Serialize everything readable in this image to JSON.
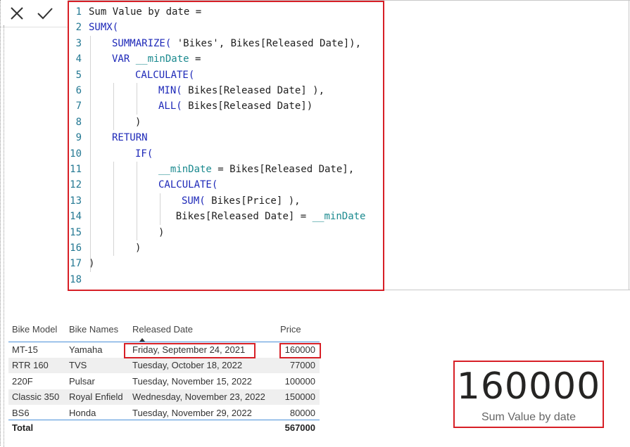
{
  "toolbar": {
    "cancel_icon": "close-icon",
    "commit_icon": "check-icon"
  },
  "editor": {
    "lines": [
      {
        "n": "1",
        "indent": 0,
        "tokens": [
          {
            "t": "Sum Value by date =",
            "c": "code"
          }
        ]
      },
      {
        "n": "2",
        "indent": 0,
        "tokens": [
          {
            "t": "SUMX(",
            "c": "fn"
          }
        ]
      },
      {
        "n": "3",
        "indent": 1,
        "tokens": [
          {
            "t": "SUMMARIZE(",
            "c": "fn"
          },
          {
            "t": " 'Bikes', Bikes[Released Date]),",
            "c": "code"
          }
        ]
      },
      {
        "n": "4",
        "indent": 1,
        "tokens": [
          {
            "t": "VAR ",
            "c": "kw"
          },
          {
            "t": "__minDate",
            "c": "var"
          },
          {
            "t": " =",
            "c": "code"
          }
        ]
      },
      {
        "n": "5",
        "indent": 2,
        "tokens": [
          {
            "t": "CALCULATE(",
            "c": "fn"
          }
        ]
      },
      {
        "n": "6",
        "indent": 3,
        "tokens": [
          {
            "t": "MIN(",
            "c": "fn"
          },
          {
            "t": " Bikes[Released Date] ),",
            "c": "code"
          }
        ]
      },
      {
        "n": "7",
        "indent": 3,
        "tokens": [
          {
            "t": "ALL(",
            "c": "fn"
          },
          {
            "t": " Bikes[Released Date])",
            "c": "code"
          }
        ]
      },
      {
        "n": "8",
        "indent": 2,
        "tokens": [
          {
            "t": ")",
            "c": "code"
          }
        ]
      },
      {
        "n": "9",
        "indent": 1,
        "tokens": [
          {
            "t": "RETURN",
            "c": "kw"
          }
        ]
      },
      {
        "n": "10",
        "indent": 2,
        "tokens": [
          {
            "t": "IF(",
            "c": "fn"
          }
        ]
      },
      {
        "n": "11",
        "indent": 3,
        "tokens": [
          {
            "t": "__minDate",
            "c": "var"
          },
          {
            "t": " = Bikes[Released Date],",
            "c": "code"
          }
        ]
      },
      {
        "n": "12",
        "indent": 3,
        "tokens": [
          {
            "t": "CALCULATE(",
            "c": "fn"
          }
        ]
      },
      {
        "n": "13",
        "indent": 4,
        "tokens": [
          {
            "t": "SUM(",
            "c": "fn"
          },
          {
            "t": " Bikes[Price] ),",
            "c": "code"
          }
        ]
      },
      {
        "n": "14",
        "indent": 3.75,
        "tokens": [
          {
            "t": "Bikes[Released Date] = ",
            "c": "code"
          },
          {
            "t": "__minDate",
            "c": "var"
          }
        ]
      },
      {
        "n": "15",
        "indent": 3,
        "tokens": [
          {
            "t": ")",
            "c": "code"
          }
        ]
      },
      {
        "n": "16",
        "indent": 2,
        "tokens": [
          {
            "t": ")",
            "c": "code"
          }
        ]
      },
      {
        "n": "17",
        "indent": 0,
        "tokens": [
          {
            "t": ")",
            "c": "code"
          }
        ]
      },
      {
        "n": "18",
        "indent": 0,
        "tokens": []
      }
    ]
  },
  "table": {
    "headers": [
      "Bike Model",
      "Bike Names",
      "Released Date",
      "Price"
    ],
    "rows": [
      [
        "MT-15",
        "Yamaha",
        "Friday, September 24, 2021",
        "160000"
      ],
      [
        "RTR 160",
        "TVS",
        "Tuesday, October 18, 2022",
        "77000"
      ],
      [
        "220F",
        "Pulsar",
        "Tuesday, November 15, 2022",
        "100000"
      ],
      [
        "Classic 350",
        "Royal Enfield",
        "Wednesday, November 23, 2022",
        "150000"
      ],
      [
        "BS6",
        "Honda",
        "Tuesday, November 29, 2022",
        "80000"
      ]
    ],
    "total_label": "Total",
    "total_value": "567000"
  },
  "card": {
    "value": "160000",
    "label": "Sum Value by date"
  },
  "colors": {
    "highlight": "#d71f26",
    "keyword": "#1d28b8",
    "variable": "#1b8a8f",
    "line_number": "#237893"
  }
}
